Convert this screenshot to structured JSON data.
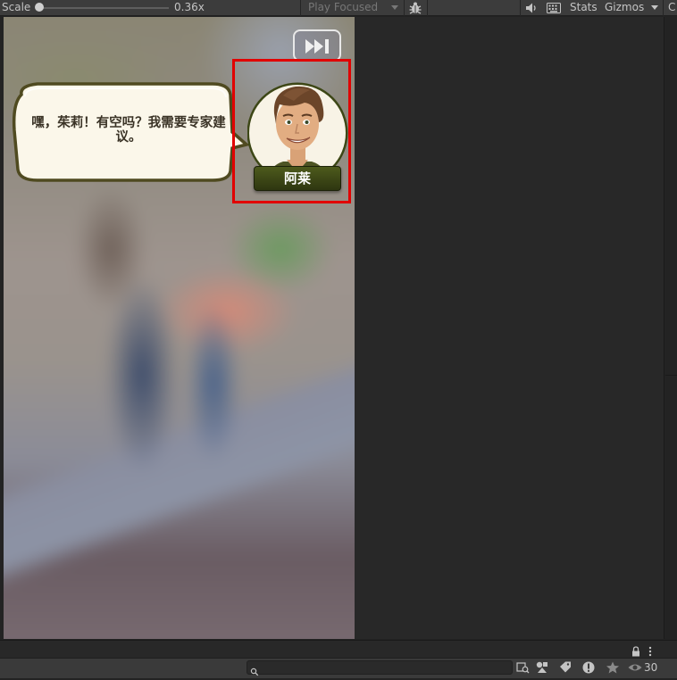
{
  "toolbar": {
    "scale_label": "Scale",
    "scale_value": "0.36x",
    "play_mode": "Play Focused",
    "stats_label": "Stats",
    "gizmos_label": "Gizmos",
    "cut_label": "C"
  },
  "game": {
    "dialogue_text": "嘿，茱莉！有空吗？我需要专家建议。",
    "speaker_name": "阿莱",
    "skip_icon": "fast-forward-icon"
  },
  "bottom": {
    "search_placeholder": "",
    "visibility_count": "30"
  },
  "colors": {
    "highlight": "#e10000",
    "name_plate": "#3d4716",
    "bubble_fill": "#fbf7ea",
    "bubble_border": "#4f4a20"
  }
}
